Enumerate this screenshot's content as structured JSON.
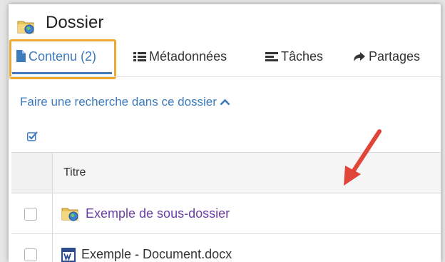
{
  "header": {
    "title": "Dossier",
    "icon": "folder-globe-icon"
  },
  "tabs": [
    {
      "label": "Contenu (2)",
      "icon": "document-icon",
      "active": true
    },
    {
      "label": "Métadonnées",
      "icon": "list-icon",
      "active": false
    },
    {
      "label": "Tâches",
      "icon": "tasks-icon",
      "active": false
    },
    {
      "label": "Partages",
      "icon": "share-arrow-icon",
      "active": false
    }
  ],
  "search": {
    "label": "Faire une recherche dans ce dossier",
    "icon": "chevron-up-icon"
  },
  "table": {
    "columns": [
      "Titre"
    ],
    "rows": [
      {
        "title": "Exemple de sous-dossier",
        "type": "folder",
        "icon": "folder-globe-icon"
      },
      {
        "title": "Exemple - Document.docx",
        "type": "word-document",
        "icon": "word-doc-icon"
      }
    ]
  },
  "colors": {
    "accent": "#3d7bbd",
    "highlight": "#f0a830",
    "link_purple": "#6b3fa6",
    "arrow_red": "#e0453a"
  }
}
